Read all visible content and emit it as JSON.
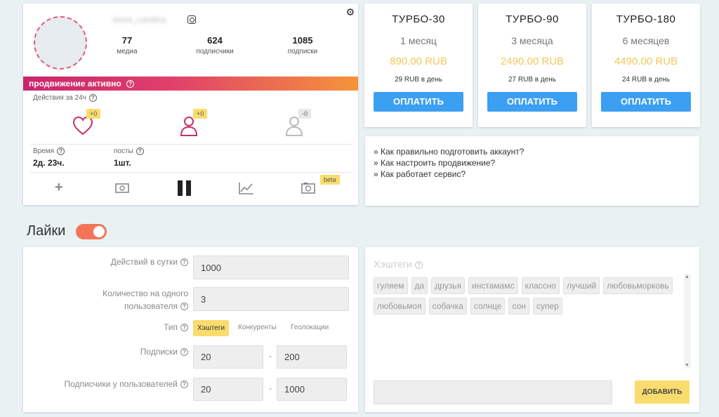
{
  "profile": {
    "username": "brest_carolina",
    "stats": [
      {
        "value": "77",
        "label": "медиа"
      },
      {
        "value": "624",
        "label": "подписчики"
      },
      {
        "value": "1085",
        "label": "подписки"
      }
    ],
    "promo_status": "продвижение активно",
    "actions_label": "Действия за 24ч",
    "actions": [
      {
        "icon": "heart-icon",
        "badge": "+0"
      },
      {
        "icon": "follow-user-icon",
        "badge": "+0"
      },
      {
        "icon": "unfollow-user-icon",
        "badge": "-0"
      }
    ],
    "time_label": "Время",
    "time_value": "2д. 23ч.",
    "posts_label": "посты",
    "posts_value": "1шт.",
    "beta_label": "beta"
  },
  "tariffs": [
    {
      "name": "ТУРБО-30",
      "period": "1 месяц",
      "price": "890.00 RUB",
      "per_day": "29 RUB в день",
      "button": "ОПЛАТИТЬ"
    },
    {
      "name": "ТУРБО-90",
      "period": "3 месяца",
      "price": "2490.00 RUB",
      "per_day": "27 RUB в день",
      "button": "ОПЛАТИТЬ"
    },
    {
      "name": "ТУРБО-180",
      "period": "6 месяцев",
      "price": "4490.00 RUB",
      "per_day": "24 RUB в день",
      "button": "ОПЛАТИТЬ"
    }
  ],
  "faq": [
    "» Как правильно подготовить аккаунт?",
    "» Как настроить продвижение?",
    "» Как работает сервис?"
  ],
  "likes": {
    "title": "Лайки",
    "enabled": true
  },
  "settings": {
    "actions_per_day_label": "Действий в сутки",
    "actions_per_day_value": "1000",
    "per_user_label_1": "Количество на одного",
    "per_user_label_2": "пользователя",
    "per_user_value": "3",
    "type_label": "Тип",
    "type_options": [
      "Хэштеги",
      "Конкуренты",
      "Геолокации"
    ],
    "subs_label": "Подписки",
    "subs_from": "20",
    "subs_to": "200",
    "followers_label": "Подписчики у пользователей",
    "followers_from": "20",
    "followers_to": "1000",
    "range_sep": "-"
  },
  "hashtags": {
    "title": "Хэштеги",
    "tags": [
      "гуляем",
      "да",
      "друзья",
      "инстамамс",
      "классно",
      "лучший",
      "любовьморковь",
      "любовьмоя",
      "собачка",
      "солнце",
      "сон",
      "супер"
    ],
    "add_button": "ДОБАВИТЬ"
  },
  "colors": {
    "accent_blue": "#3b9ff2",
    "price_yellow": "#f3c85a",
    "toggle_on": "#f47458",
    "badge_yellow": "#f9dc6d"
  }
}
